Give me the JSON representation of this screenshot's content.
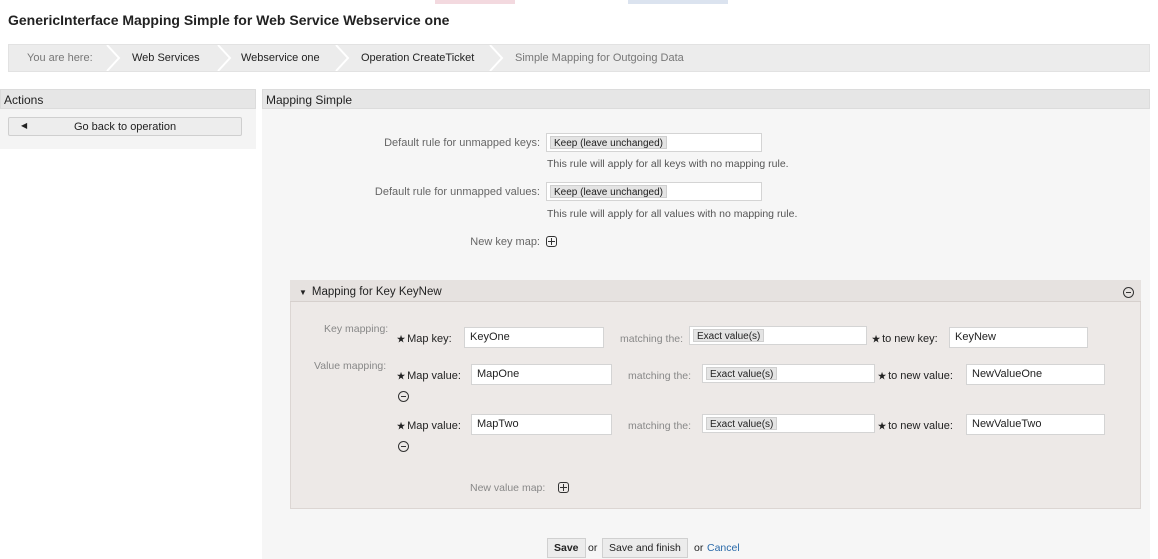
{
  "page_title": "GenericInterface Mapping Simple for Web Service Webservice one",
  "breadcrumb": {
    "prefix": "You are here:",
    "items": [
      "Web Services",
      "Webservice one",
      "Operation CreateTicket",
      "Simple Mapping for Outgoing Data"
    ]
  },
  "sidebar": {
    "title": "Actions",
    "back_button": "Go back to operation"
  },
  "main": {
    "title": "Mapping Simple",
    "default_keys_label": "Default rule for unmapped keys:",
    "default_keys_value": "Keep (leave unchanged)",
    "default_keys_hint": "This rule will apply for all keys with no mapping rule.",
    "default_values_label": "Default rule for unmapped values:",
    "default_values_value": "Keep (leave unchanged)",
    "default_values_hint": "This rule will apply for all values with no mapping rule.",
    "new_key_map_label": "New key map:"
  },
  "key_mapping": {
    "title": "Mapping for Key KeyNew",
    "key_mapping_label": "Key mapping:",
    "map_key_label": "Map key:",
    "map_key_value": "KeyOne",
    "matching_label": "matching the:",
    "matching_value": "Exact value(s)",
    "to_new_key_label": "to new key:",
    "to_new_key_value": "KeyNew",
    "value_mapping_label": "Value mapping:",
    "values": [
      {
        "map_value_label": "Map value:",
        "map_value": "MapOne",
        "matching_label": "matching the:",
        "matching_value": "Exact value(s)",
        "to_new_value_label": "to new value:",
        "to_new_value": "NewValueOne"
      },
      {
        "map_value_label": "Map value:",
        "map_value": "MapTwo",
        "matching_label": "matching the:",
        "matching_value": "Exact value(s)",
        "to_new_value_label": "to new value:",
        "to_new_value": "NewValueTwo"
      }
    ],
    "new_value_map_label": "New value map:"
  },
  "footer": {
    "save": "Save",
    "or1": "or",
    "save_finish": "Save and finish",
    "or2": "or",
    "cancel": "Cancel"
  },
  "colors": {
    "link": "#2a6aa9",
    "header_bg": "#e6e6e6",
    "key_box_bg": "#ede9e7"
  }
}
